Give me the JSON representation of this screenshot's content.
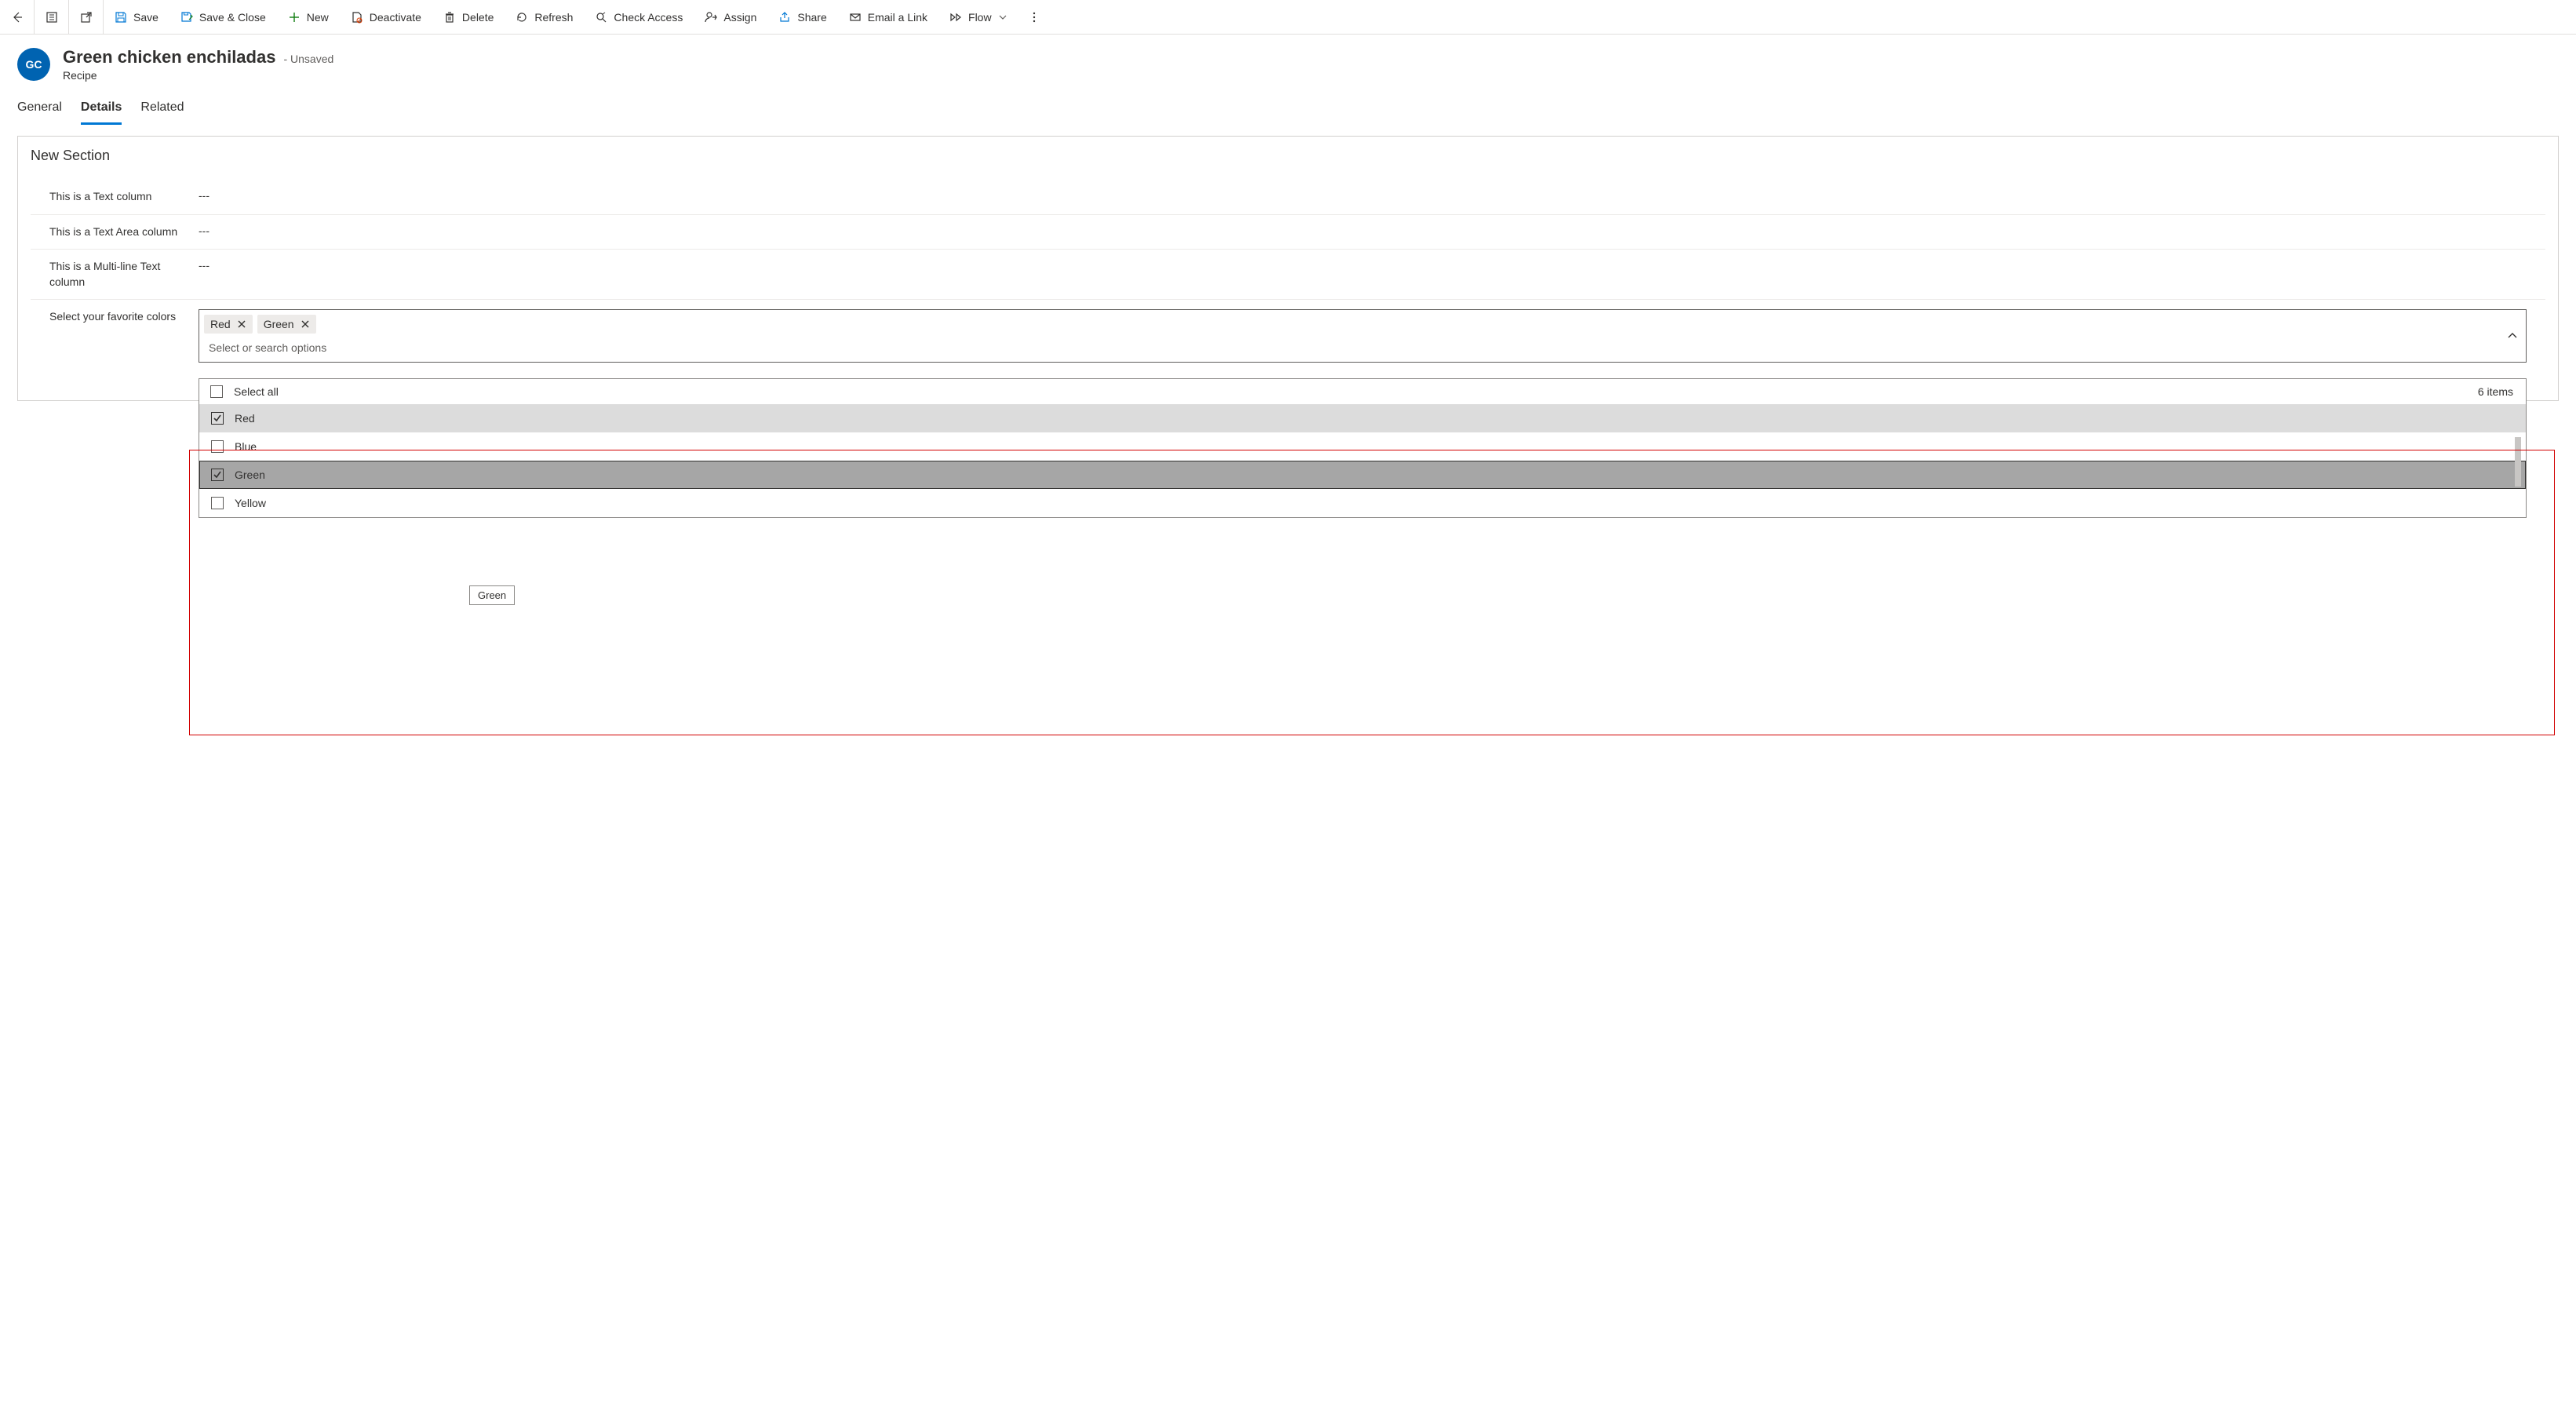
{
  "toolbar": {
    "save": "Save",
    "save_close": "Save & Close",
    "new": "New",
    "deactivate": "Deactivate",
    "delete": "Delete",
    "refresh": "Refresh",
    "check_access": "Check Access",
    "assign": "Assign",
    "share": "Share",
    "email_link": "Email a Link",
    "flow": "Flow"
  },
  "header": {
    "initials": "GC",
    "title": "Green chicken enchiladas",
    "status": "- Unsaved",
    "entity": "Recipe"
  },
  "tabs": {
    "general": "General",
    "details": "Details",
    "related": "Related"
  },
  "section": {
    "title": "New Section",
    "fields": {
      "text": {
        "label": "This is a Text column",
        "value": "---"
      },
      "textarea": {
        "label": "This is a Text Area column",
        "value": "---"
      },
      "multiline": {
        "label": "This is a Multi-line Text column",
        "value": "---"
      },
      "colors": {
        "label": "Select your favorite colors"
      }
    }
  },
  "combo": {
    "placeholder": "Select or search options",
    "chips": {
      "red": "Red",
      "green": "Green"
    },
    "select_all": "Select all",
    "count_label": "6 items",
    "options": {
      "red": "Red",
      "blue": "Blue",
      "green": "Green",
      "yellow": "Yellow"
    },
    "tooltip": "Green"
  }
}
